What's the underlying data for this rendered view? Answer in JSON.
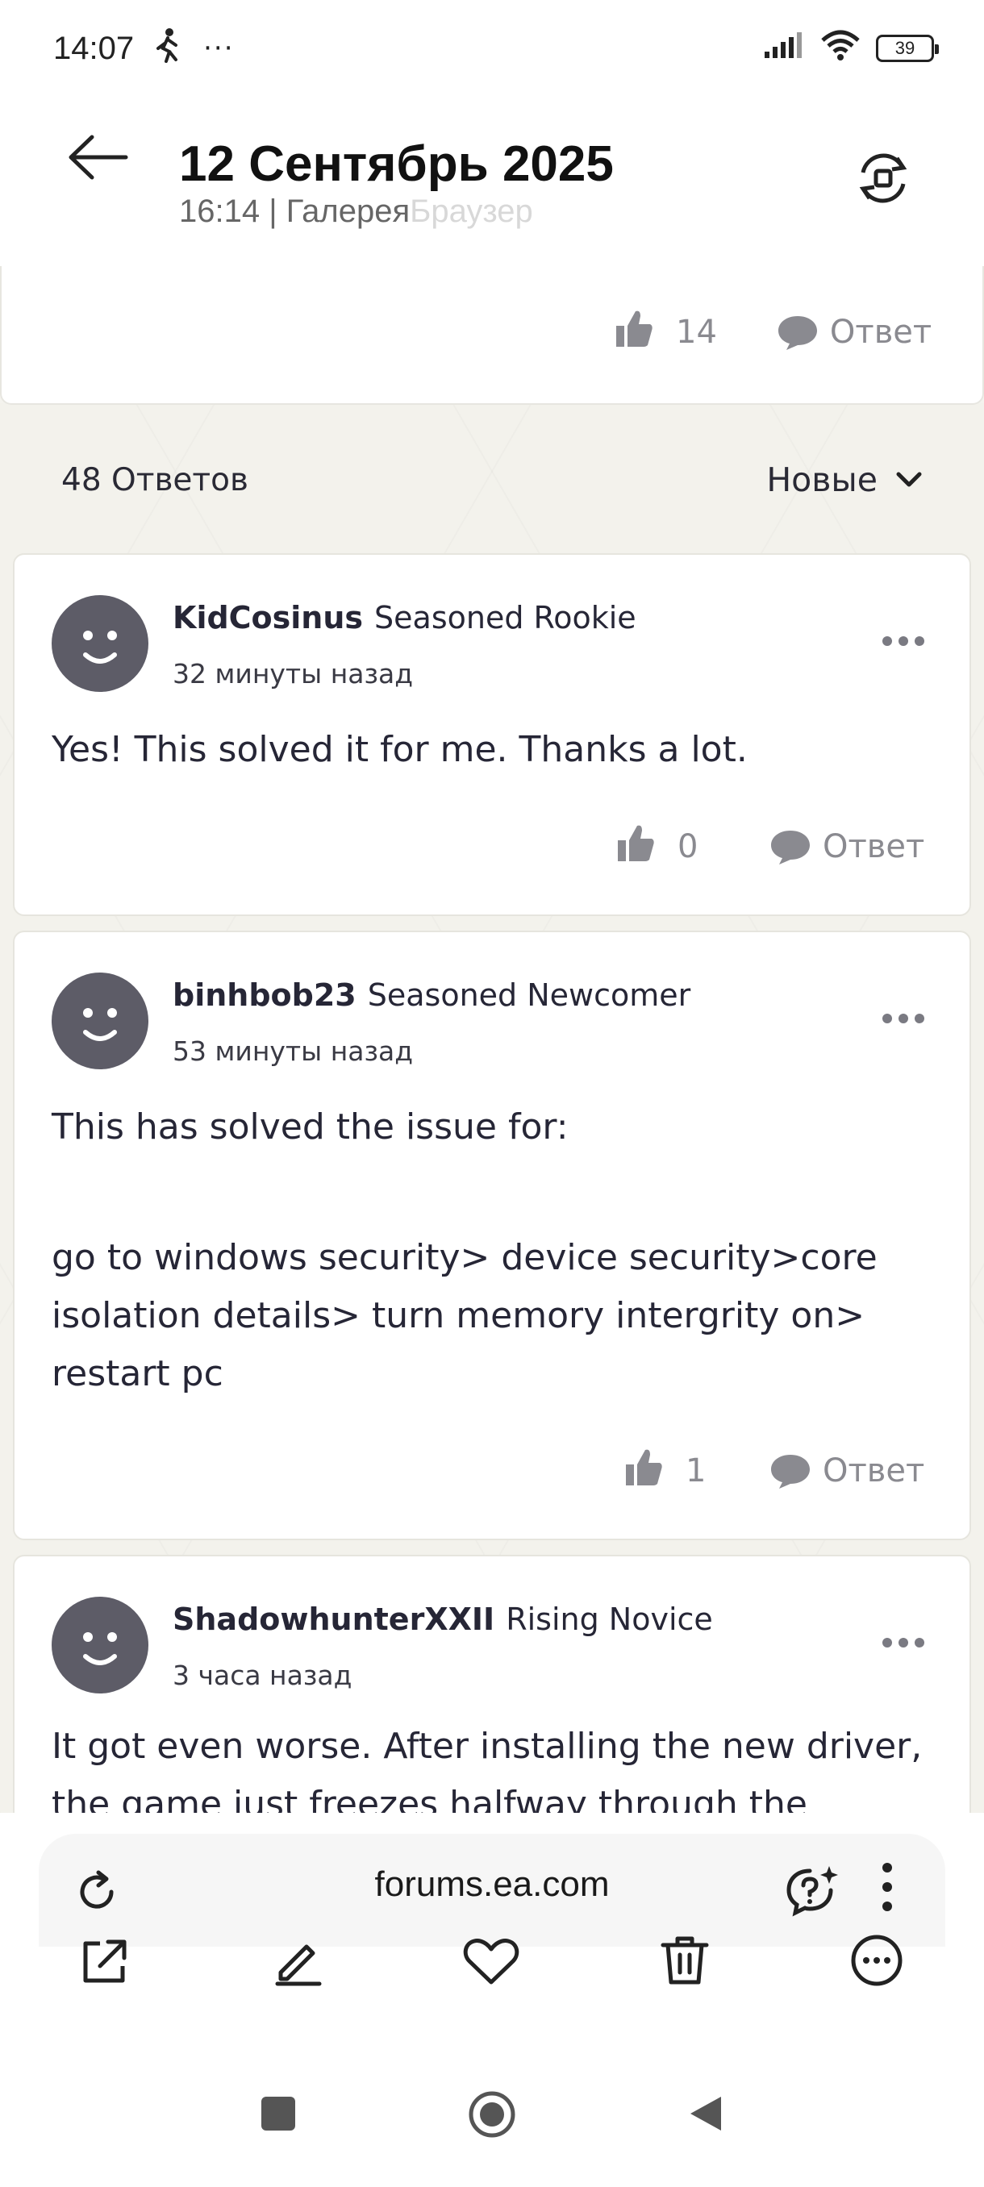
{
  "status_bar": {
    "time": "14:07",
    "battery": "39"
  },
  "header": {
    "title": "12 Сентябрь 2025",
    "subtitle": "16:14 | Галерея",
    "subtitle_ghost": "Браузер"
  },
  "previous_post": {
    "likes": "14",
    "reply_label": "Ответ"
  },
  "answers": {
    "count_label": "48 Ответов",
    "sort_label": "Новые"
  },
  "posts": [
    {
      "username": "KidCosinus",
      "rank": "Seasoned Rookie",
      "time_ago": "32 минуты назад",
      "text_lines": [
        "Yes! This solved it for me. Thanks a lot."
      ],
      "likes": "0",
      "reply_label": "Ответ"
    },
    {
      "username": "binhbob23",
      "rank": "Seasoned Newcomer",
      "time_ago": "53 минуты назад",
      "text_lines": [
        "This has solved the issue for:",
        "",
        "go to windows security> device security>core",
        "isolation details> turn memory intergrity on>",
        "restart pc"
      ],
      "likes": "1",
      "reply_label": "Ответ"
    },
    {
      "username": "ShadowhunterXXII",
      "rank": "Rising Novice",
      "time_ago": "3 часа назад",
      "text_lines": [
        "It got even worse. After installing the new driver,",
        "the game just freezes halfway through the loading"
      ]
    }
  ],
  "browser": {
    "url": "forums.ea.com"
  },
  "colors": {
    "avatar": "#5d5c67",
    "muted": "#8a8a90",
    "text": "#262636"
  }
}
